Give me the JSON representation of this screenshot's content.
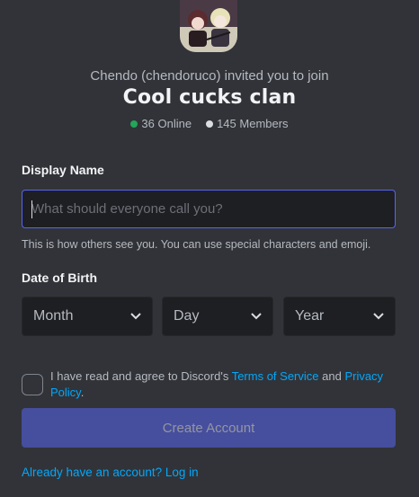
{
  "invite": {
    "inviter_text": "Chendo (chendoruco) invited you to join",
    "server_name": "Cool cucks clan",
    "online_count": "36 Online",
    "member_count": "145 Members",
    "online_color": "#23a55a",
    "member_color": "#dbdee1"
  },
  "form": {
    "display_name_label": "Display Name",
    "display_name_placeholder": "What should everyone call you?",
    "display_name_value": "",
    "display_name_hint": "This is how others see you. You can use special characters and emoji.",
    "dob_label": "Date of Birth",
    "month_placeholder": "Month",
    "day_placeholder": "Day",
    "year_placeholder": "Year",
    "tos_prefix": "I have read and agree to Discord's ",
    "tos_link": "Terms of Service",
    "tos_and": " and ",
    "privacy_link": "Privacy Policy",
    "tos_suffix": ".",
    "checkbox_checked": false,
    "create_button": "Create Account",
    "login_link": "Already have an account? Log in"
  },
  "icons": {
    "server_avatar": "server-avatar-image",
    "chevron": "chevron-down-icon"
  },
  "colors": {
    "background": "#313338",
    "accent": "#5865f2",
    "link": "#00a8fc"
  }
}
